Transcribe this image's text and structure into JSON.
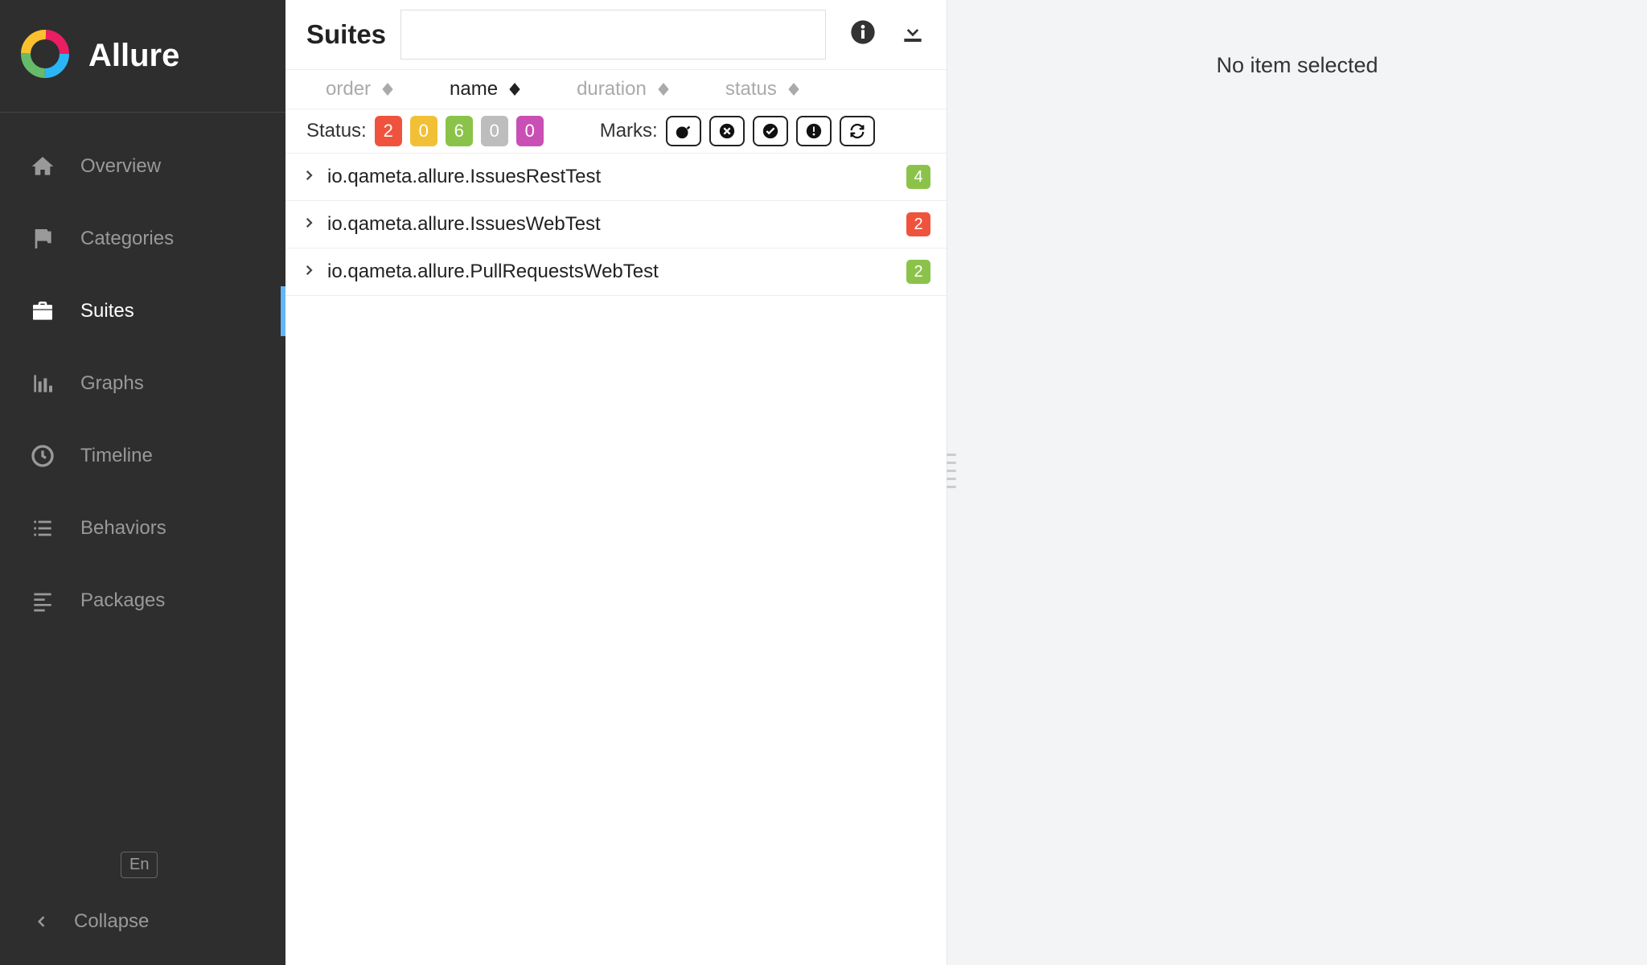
{
  "brand": {
    "name": "Allure"
  },
  "sidebar": {
    "items": [
      {
        "key": "overview",
        "label": "Overview"
      },
      {
        "key": "categories",
        "label": "Categories"
      },
      {
        "key": "suites",
        "label": "Suites"
      },
      {
        "key": "graphs",
        "label": "Graphs"
      },
      {
        "key": "timeline",
        "label": "Timeline"
      },
      {
        "key": "behaviors",
        "label": "Behaviors"
      },
      {
        "key": "packages",
        "label": "Packages"
      }
    ],
    "language": "En",
    "collapse": "Collapse"
  },
  "mid": {
    "title": "Suites",
    "search_value": "",
    "sort": {
      "order": "order",
      "name": "name",
      "duration": "duration",
      "status": "status"
    },
    "filters": {
      "status_label": "Status:",
      "status_counts": {
        "failed": "2",
        "broken": "0",
        "passed": "6",
        "skipped": "0",
        "unknown": "0"
      },
      "marks_label": "Marks:"
    },
    "tree": [
      {
        "name": "io.qameta.allure.IssuesRestTest",
        "count": "4",
        "color": "green"
      },
      {
        "name": "io.qameta.allure.IssuesWebTest",
        "count": "2",
        "color": "red"
      },
      {
        "name": "io.qameta.allure.PullRequestsWebTest",
        "count": "2",
        "color": "green"
      }
    ]
  },
  "detail": {
    "empty": "No item selected"
  }
}
